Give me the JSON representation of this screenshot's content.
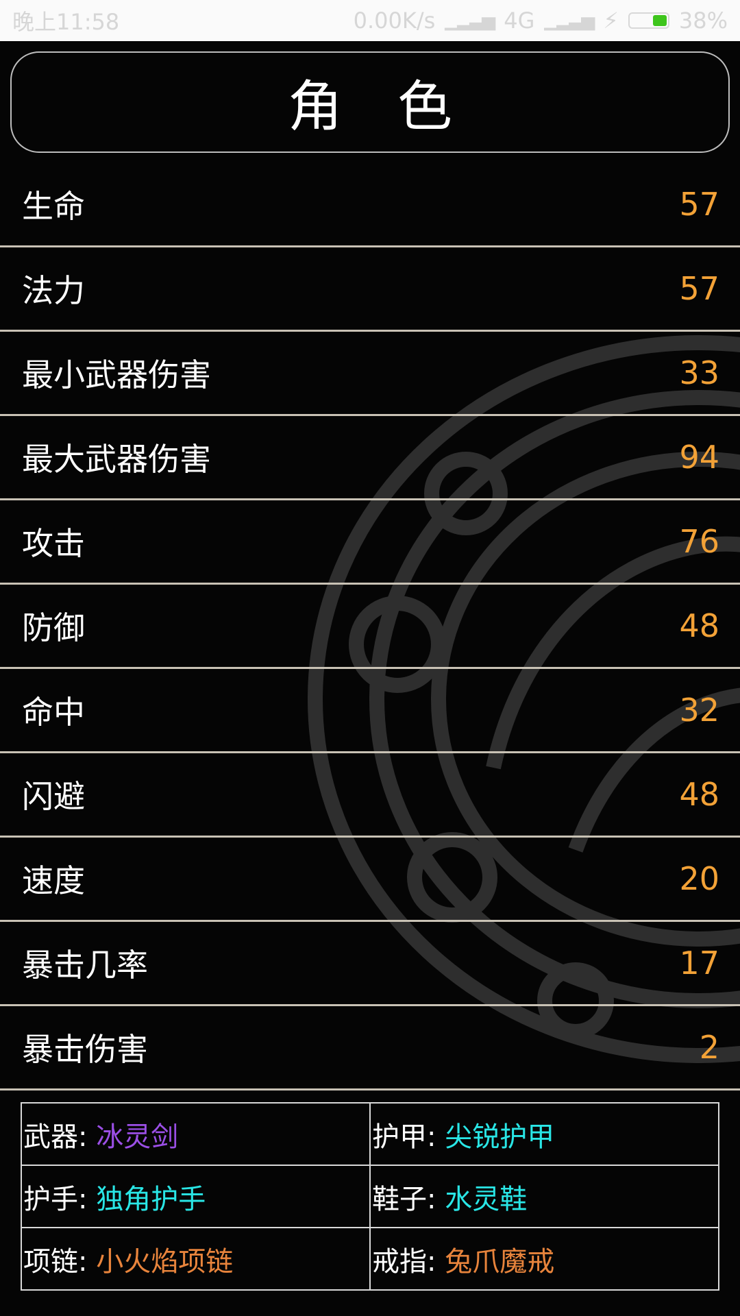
{
  "status_bar": {
    "time": "晚上11:58",
    "net_speed": "0.00K/s",
    "network": "4G",
    "battery": "38%",
    "battery_color": "#3ec51c"
  },
  "title": "角色",
  "stats": [
    {
      "label": "生命",
      "value": "57"
    },
    {
      "label": "法力",
      "value": "57"
    },
    {
      "label": "最小武器伤害",
      "value": "33"
    },
    {
      "label": "最大武器伤害",
      "value": "94"
    },
    {
      "label": "攻击",
      "value": "76"
    },
    {
      "label": "防御",
      "value": "48"
    },
    {
      "label": "命中",
      "value": "32"
    },
    {
      "label": "闪避",
      "value": "48"
    },
    {
      "label": "速度",
      "value": "20"
    },
    {
      "label": "暴击几率",
      "value": "17"
    },
    {
      "label": "暴击伤害",
      "value": "2"
    }
  ],
  "equipment": {
    "weapon": {
      "label": "武器:",
      "item": "冰灵剑",
      "color": "#9b4fe6"
    },
    "armor": {
      "label": "护甲:",
      "item": "尖锐护甲",
      "color": "#29e6e6"
    },
    "gloves": {
      "label": "护手:",
      "item": "独角护手",
      "color": "#29e6e6"
    },
    "shoes": {
      "label": "鞋子:",
      "item": "水灵鞋",
      "color": "#29e6e6"
    },
    "necklace": {
      "label": "项链:",
      "item": "小火焰项链",
      "color": "#e8843c"
    },
    "ring": {
      "label": "戒指:",
      "item": "兔爪魔戒",
      "color": "#e8843c"
    }
  },
  "colors": {
    "background": "#050505",
    "stat_value": "#f3a237",
    "divider": "#c9c2b5"
  }
}
